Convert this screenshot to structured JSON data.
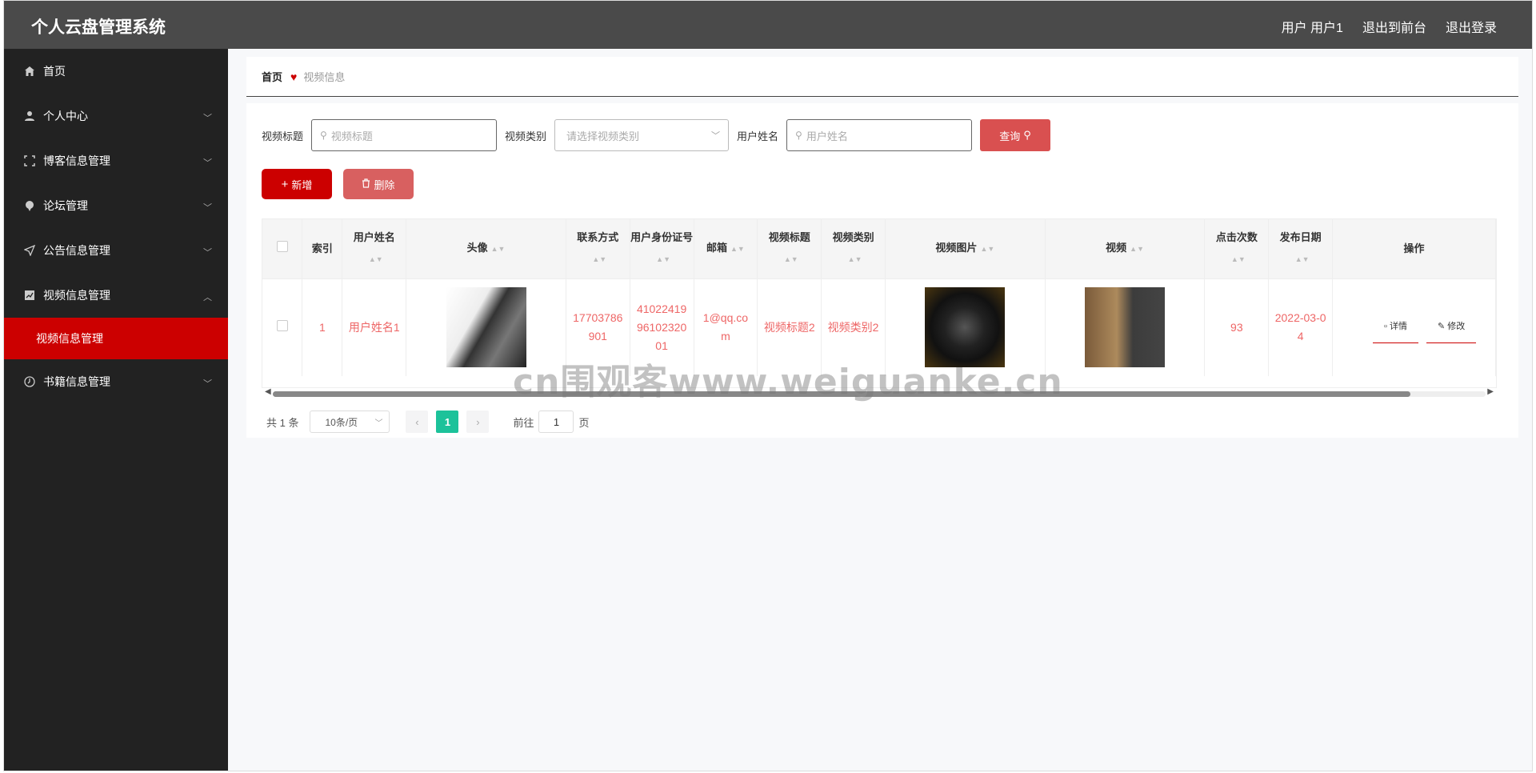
{
  "header": {
    "title": "个人云盘管理系统",
    "user_label": "用户 用户1",
    "to_front": "退出到前台",
    "logout": "退出登录"
  },
  "sidebar": {
    "items": [
      {
        "label": "首页",
        "icon": "home-icon"
      },
      {
        "label": "个人中心",
        "icon": "user-icon"
      },
      {
        "label": "博客信息管理",
        "icon": "frame-icon"
      },
      {
        "label": "论坛管理",
        "icon": "pin-icon"
      },
      {
        "label": "公告信息管理",
        "icon": "send-icon"
      },
      {
        "label": "视频信息管理",
        "icon": "chart-icon"
      },
      {
        "label": "书籍信息管理",
        "icon": "clock-icon"
      }
    ],
    "active_sub": "视频信息管理"
  },
  "breadcrumb": {
    "home": "首页",
    "current": "视频信息"
  },
  "search": {
    "title_label": "视频标题",
    "title_placeholder": "视频标题",
    "type_label": "视频类别",
    "type_placeholder": "请选择视频类别",
    "user_label": "用户姓名",
    "user_placeholder": "用户姓名",
    "query_button": "查询"
  },
  "actions": {
    "add": "新增",
    "delete": "删除"
  },
  "table": {
    "columns": [
      "索引",
      "用户姓名",
      "头像",
      "联系方式",
      "用户身份证号",
      "邮箱",
      "视频标题",
      "视频类别",
      "视频图片",
      "视频",
      "点击次数",
      "发布日期",
      "操作"
    ],
    "rows": [
      {
        "index": "1",
        "username": "用户姓名1",
        "phone": "17703786901",
        "id_card": "410224199610232001",
        "email": "1@qq.com",
        "video_title": "视频标题2",
        "video_type": "视频类别2",
        "clicks": "93",
        "date": "2022-03-04",
        "op_detail": "详情",
        "op_edit": "修改"
      }
    ]
  },
  "pagination": {
    "total": "共 1 条",
    "page_size": "10条/页",
    "current_page": "1",
    "goto_label": "前往",
    "goto_value": "1",
    "page_unit": "页"
  },
  "watermark": "cn围观客www.weiguanke.cn",
  "colors": {
    "accent": "#cc0000",
    "topbar": "#4a4a4a",
    "sidebar": "#222222",
    "pager_active": "#1cc29a"
  }
}
